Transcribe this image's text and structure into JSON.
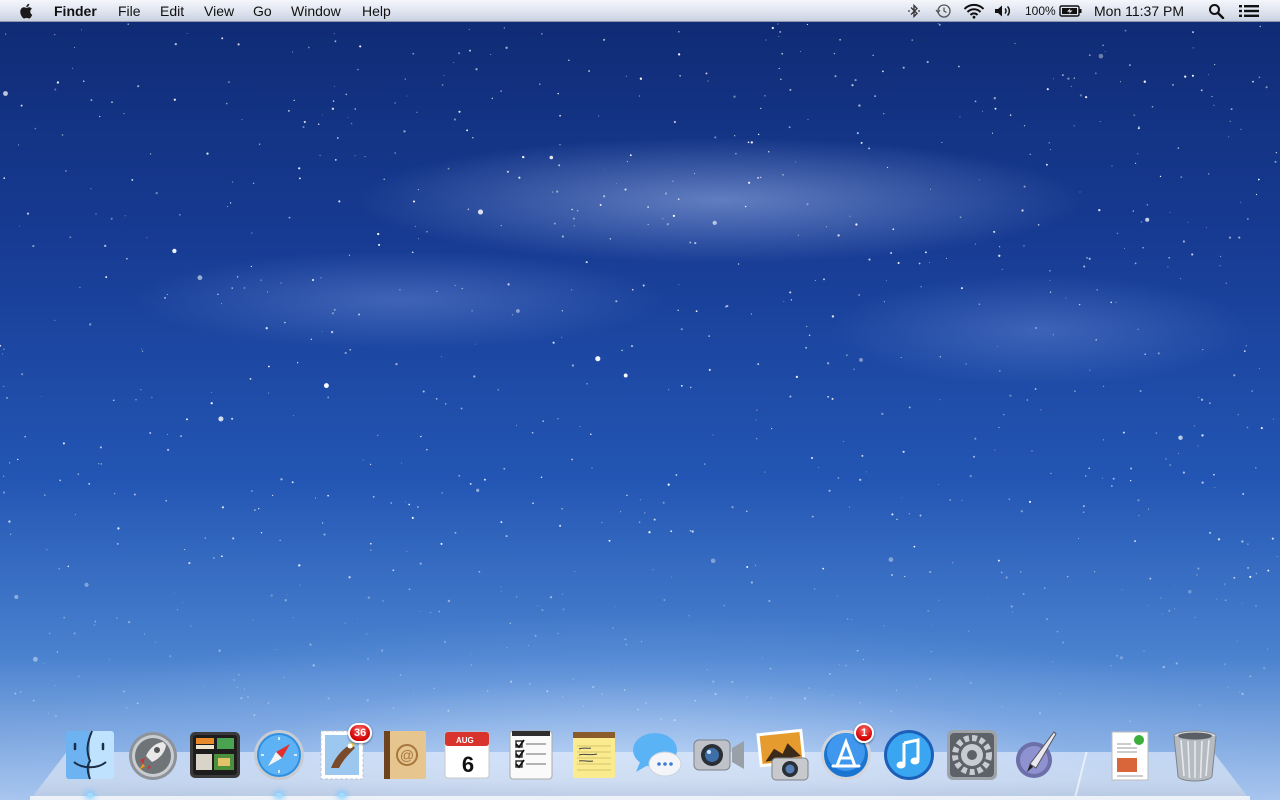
{
  "menubar": {
    "apple_icon": "apple-logo-icon",
    "app_name": "Finder",
    "menus": [
      "File",
      "Edit",
      "View",
      "Go",
      "Window",
      "Help"
    ],
    "status": {
      "bluetooth_icon": "bluetooth-icon",
      "time_machine_icon": "time-machine-icon",
      "wifi_icon": "wifi-icon",
      "volume_icon": "volume-icon",
      "battery_percent": "100%",
      "battery_icon": "battery-charging-icon",
      "clock": "Mon 11:37 PM",
      "spotlight_icon": "spotlight-search-icon",
      "notification_icon": "notification-center-icon"
    }
  },
  "dock": {
    "apps": [
      {
        "name": "Finder",
        "icon": "finder-icon"
      },
      {
        "name": "Launchpad",
        "icon": "launchpad-rocket-icon"
      },
      {
        "name": "Mission Control",
        "icon": "mission-control-icon"
      },
      {
        "name": "Safari",
        "icon": "safari-compass-icon"
      },
      {
        "name": "Mail",
        "icon": "mail-stamp-icon",
        "badge": "36"
      },
      {
        "name": "Contacts",
        "icon": "contacts-book-icon"
      },
      {
        "name": "Calendar",
        "icon": "calendar-icon",
        "month": "AUG",
        "day": "6"
      },
      {
        "name": "Reminders",
        "icon": "reminders-checklist-icon"
      },
      {
        "name": "Notes",
        "icon": "notes-pad-icon"
      },
      {
        "name": "Messages",
        "icon": "messages-bubble-icon"
      },
      {
        "name": "FaceTime",
        "icon": "facetime-camera-icon"
      },
      {
        "name": "Photo Booth",
        "icon": "photo-booth-icon"
      },
      {
        "name": "App Store",
        "icon": "app-store-icon",
        "badge": "1"
      },
      {
        "name": "iTunes",
        "icon": "itunes-note-icon"
      },
      {
        "name": "System Preferences",
        "icon": "system-preferences-gear-icon"
      },
      {
        "name": "Script Editor",
        "icon": "script-editor-quill-icon"
      }
    ],
    "documents": {
      "name": "Documents",
      "icon": "document-stack-icon"
    },
    "trash": {
      "name": "Trash",
      "icon": "trash-can-icon"
    }
  },
  "colors": {
    "badge_red": "#d10000",
    "menubar_top": "#f4f6fb",
    "desktop_dark": "#0f2a73",
    "desktop_light": "#a9c6ee"
  }
}
